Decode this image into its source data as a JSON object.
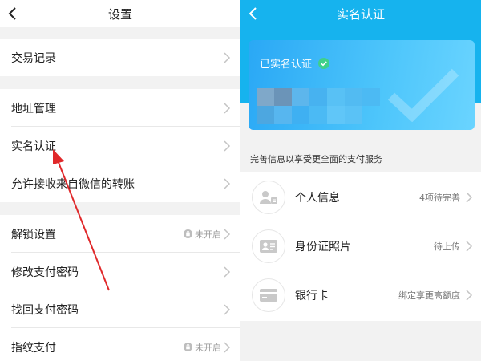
{
  "settings": {
    "title": "设置",
    "items": [
      {
        "label": "交易记录",
        "status": ""
      },
      {
        "label": "地址管理",
        "status": ""
      },
      {
        "label": "实名认证",
        "status": ""
      },
      {
        "label": "允许接收来自微信的转账",
        "status": ""
      },
      {
        "label": "解锁设置",
        "status": "未开启"
      },
      {
        "label": "修改支付密码",
        "status": ""
      },
      {
        "label": "找回支付密码",
        "status": ""
      },
      {
        "label": "指纹支付",
        "status": "未开启"
      }
    ]
  },
  "verification": {
    "title": "实名认证",
    "card_status": "已实名认证",
    "subtitle": "完善信息以享受更全面的支付服务",
    "items": [
      {
        "label": "个人信息",
        "status": "4项待完善",
        "icon": "person-card-icon"
      },
      {
        "label": "身份证照片",
        "status": "待上传",
        "icon": "id-card-icon"
      },
      {
        "label": "银行卡",
        "status": "绑定享更高额度",
        "icon": "bank-card-icon"
      }
    ]
  },
  "colors": {
    "header_blue": "#16b3ee",
    "card_blue": "#2aa8f5",
    "check_green": "#3fd08a",
    "arrow_red": "#e0282a"
  }
}
